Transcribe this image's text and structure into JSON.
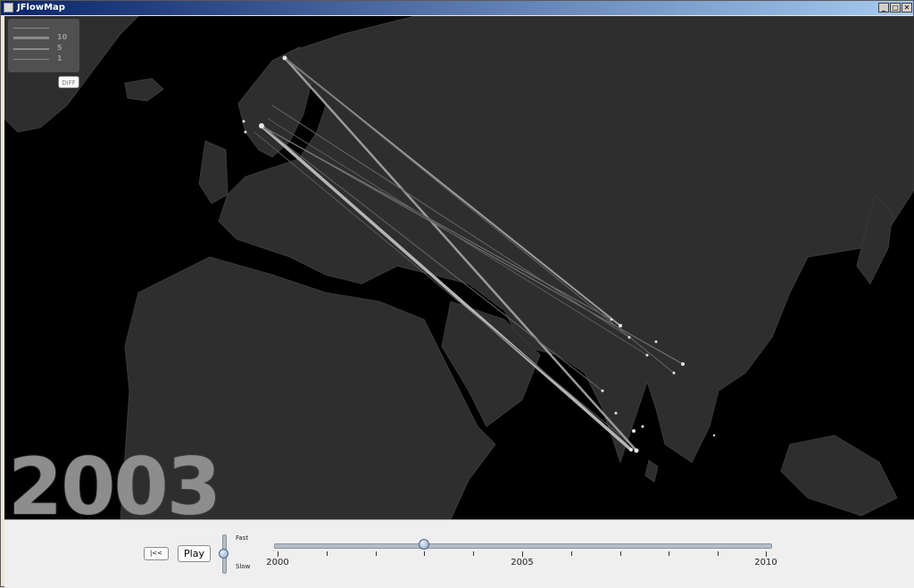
{
  "window": {
    "title": "JFlowMap",
    "minimize_label": "_",
    "maximize_label": "□",
    "close_label": "✕",
    "app_icon": "java-cup-icon"
  },
  "legend": {
    "entries": [
      "",
      "10",
      "5",
      "1"
    ],
    "diff_label": "DIFF"
  },
  "map": {
    "year_label": "2003",
    "background_color": "#000000",
    "land_color": "#2e2e2e"
  },
  "controls": {
    "rewind_label": "|<<",
    "play_label": "Play",
    "speed_fast_label": "Fast",
    "speed_slow_label": "Slow",
    "timeline": {
      "min": 2000,
      "max": 2010,
      "value": 2003,
      "labels": [
        "2000",
        "2005",
        "2010"
      ]
    }
  }
}
